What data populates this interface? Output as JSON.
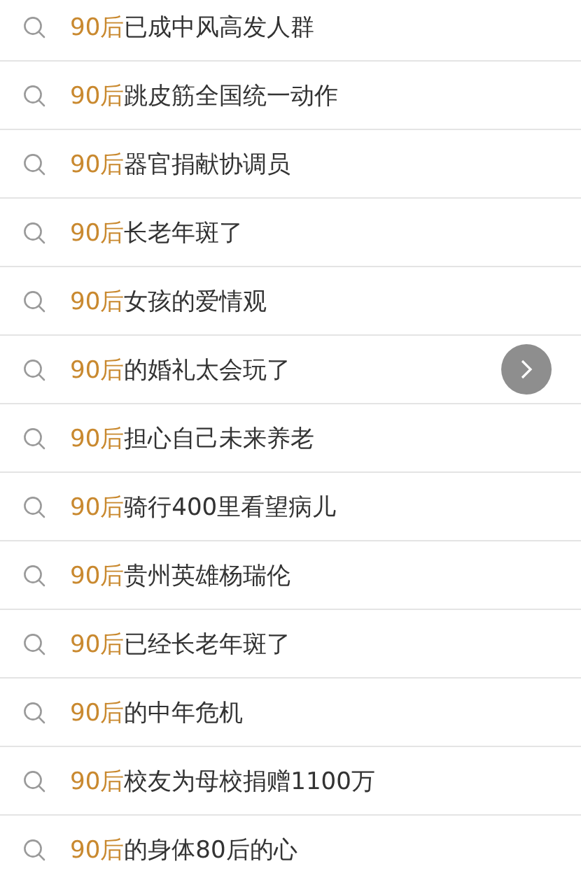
{
  "suggestions": [
    {
      "highlight": "90后",
      "rest": "已成中风高发人群"
    },
    {
      "highlight": "90后",
      "rest": "跳皮筋全国统一动作"
    },
    {
      "highlight": "90后",
      "rest": "器官捐献协调员"
    },
    {
      "highlight": "90后",
      "rest": "长老年斑了"
    },
    {
      "highlight": "90后",
      "rest": "女孩的爱情观"
    },
    {
      "highlight": "90后",
      "rest": "的婚礼太会玩了",
      "next_button": true
    },
    {
      "highlight": "90后",
      "rest": "担心自己未来养老"
    },
    {
      "highlight": "90后",
      "rest": "骑行400里看望病儿"
    },
    {
      "highlight": "90后",
      "rest": "贵州英雄杨瑞伦"
    },
    {
      "highlight": "90后",
      "rest": "已经长老年斑了"
    },
    {
      "highlight": "90后",
      "rest": "的中年危机"
    },
    {
      "highlight": "90后",
      "rest": "校友为母校捐赠1100万"
    },
    {
      "highlight": "90后",
      "rest": "的身体80后的心"
    }
  ]
}
